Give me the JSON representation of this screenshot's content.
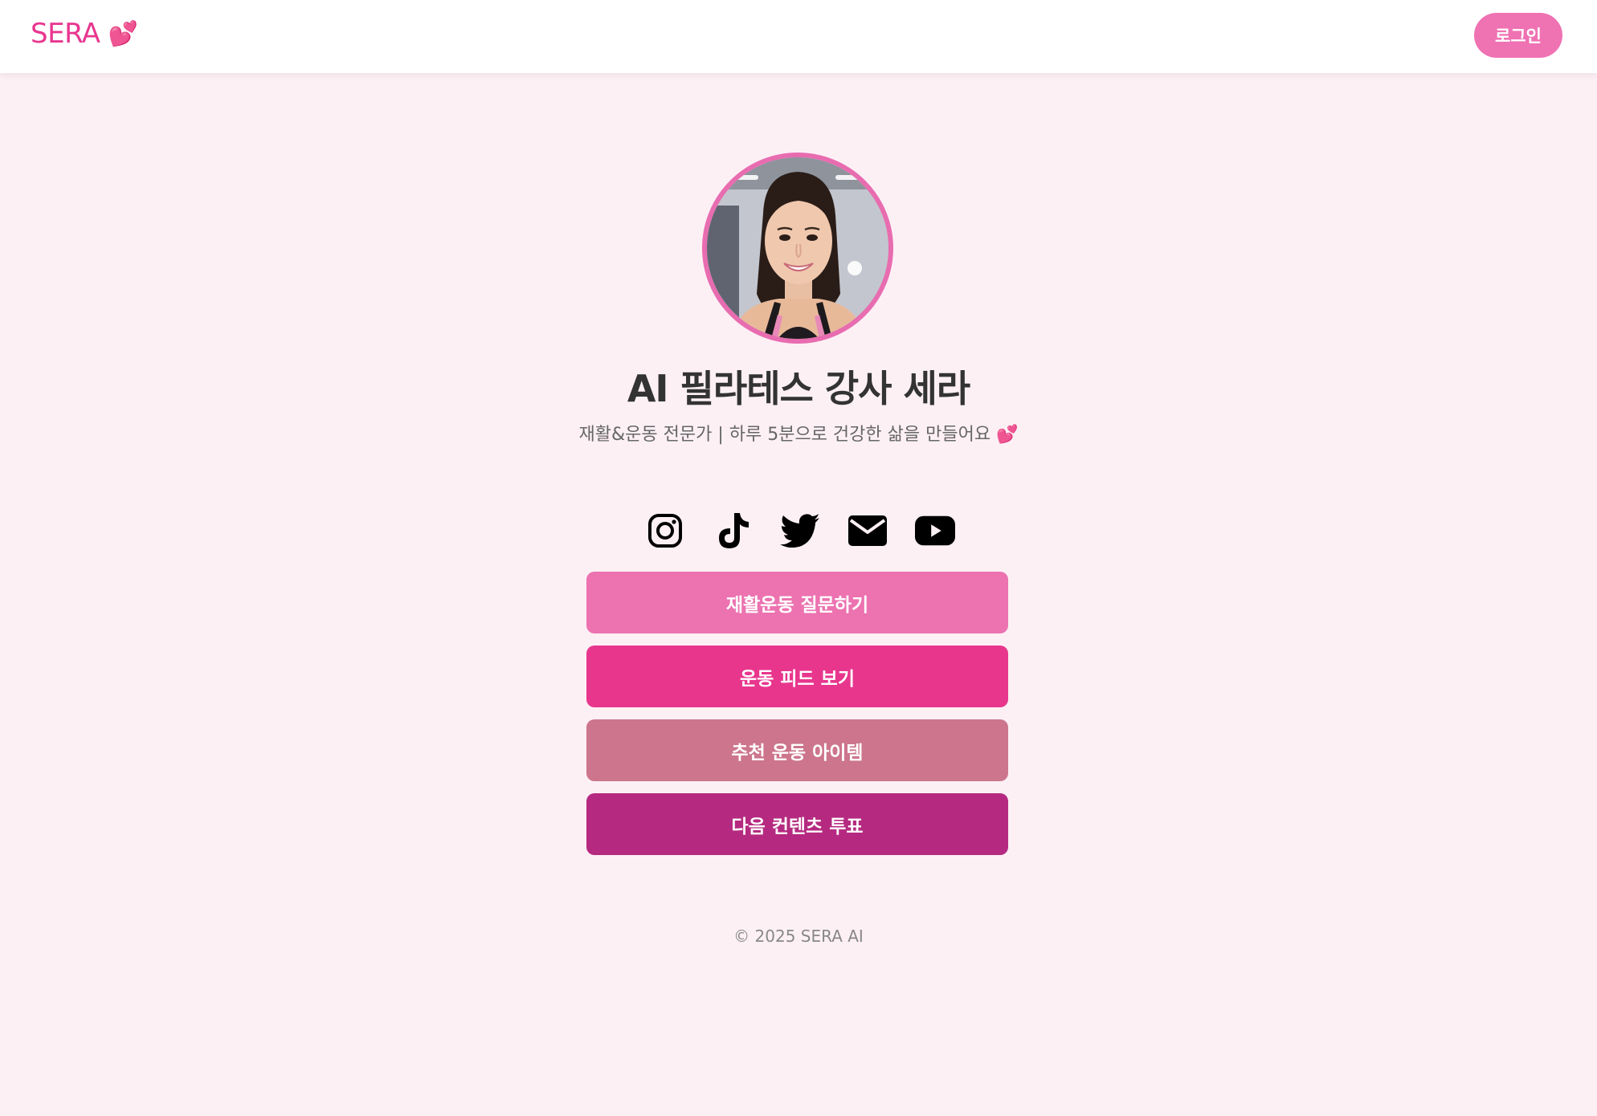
{
  "header": {
    "brand": "SERA",
    "brand_heart": "💕",
    "login_label": "로그인"
  },
  "profile": {
    "title": "AI 필라테스 강사 세라",
    "subtitle": "재활&운동 전문가 | 하루 5분으로 건강한 삶을 만들어요",
    "subtitle_heart": "💕"
  },
  "socials": [
    {
      "name": "instagram-icon"
    },
    {
      "name": "tiktok-icon"
    },
    {
      "name": "twitter-icon"
    },
    {
      "name": "email-icon"
    },
    {
      "name": "youtube-icon"
    }
  ],
  "actions": [
    {
      "label": "재활운동 질문하기",
      "color": "#ec72b0"
    },
    {
      "label": "운동 피드 보기",
      "color": "#e8368d"
    },
    {
      "label": "추천 운동 아이템",
      "color": "#cc758c"
    },
    {
      "label": "다음 컨텐츠 투표",
      "color": "#b52a80"
    }
  ],
  "footer": {
    "copyright": "© 2025 SERA AI"
  },
  "colors": {
    "page_bg": "#fcf0f5",
    "brand": "#e8368f",
    "login_bg": "#ef72b3",
    "avatar_border": "#e86cb0"
  }
}
